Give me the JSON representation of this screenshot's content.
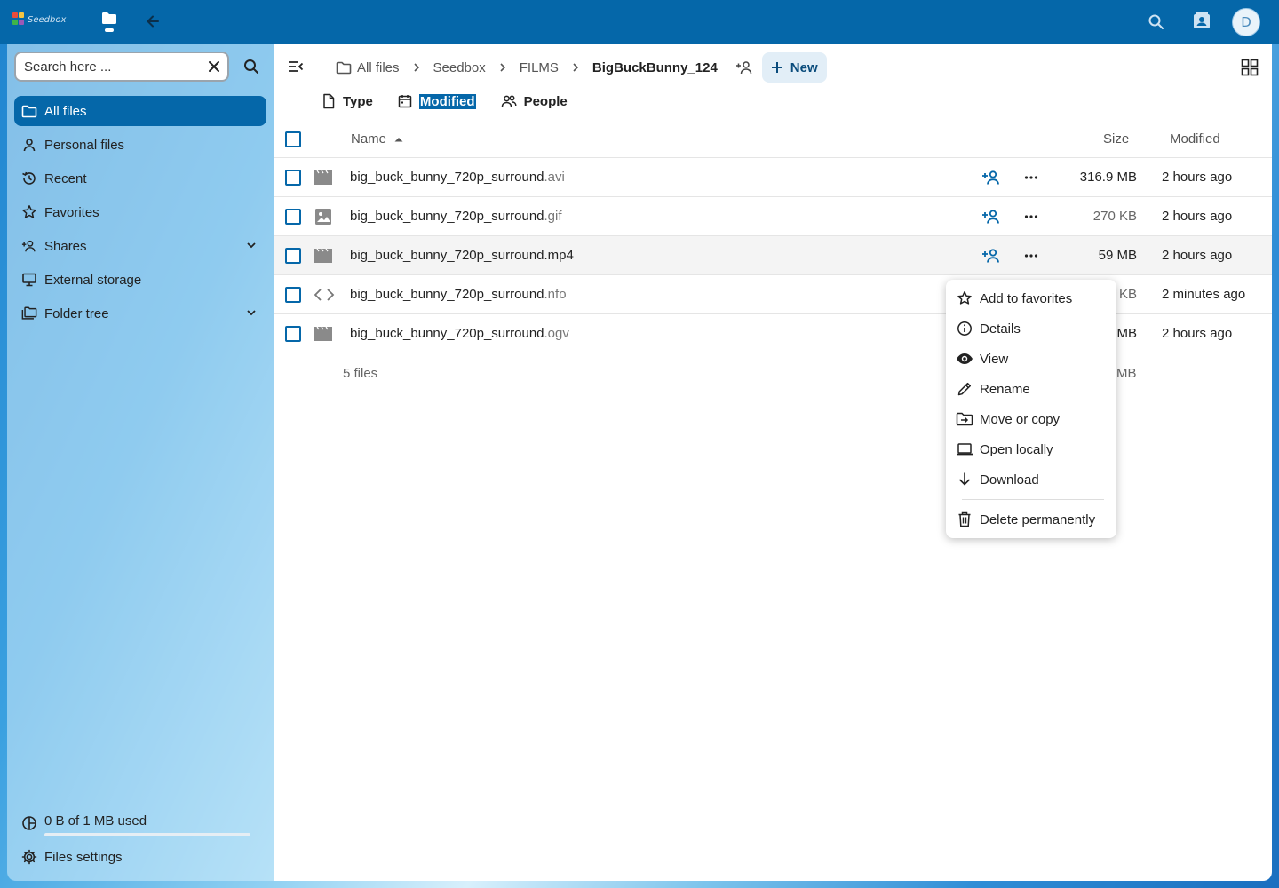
{
  "topbar": {
    "logo_text": "Seedbox",
    "avatar_initial": "D"
  },
  "sidebar": {
    "search_placeholder": "Search here ...",
    "items": [
      {
        "label": "All files",
        "icon": "folder-icon",
        "active": true
      },
      {
        "label": "Personal files",
        "icon": "person-icon"
      },
      {
        "label": "Recent",
        "icon": "history-icon"
      },
      {
        "label": "Favorites",
        "icon": "star-icon"
      },
      {
        "label": "Shares",
        "icon": "share-icon",
        "expandable": true
      },
      {
        "label": "External storage",
        "icon": "monitor-icon"
      },
      {
        "label": "Folder tree",
        "icon": "folder-multiple-icon",
        "expandable": true
      }
    ],
    "quota_text": "0 B of 1 MB used",
    "quota_used_fraction": 0,
    "settings_label": "Files settings"
  },
  "breadcrumb": {
    "items": [
      "All files",
      "Seedbox",
      "FILMS",
      "BigBuckBunny_124"
    ],
    "new_label": "New"
  },
  "filters": {
    "type": "Type",
    "modified": "Modified",
    "people": "People"
  },
  "table": {
    "col_name": "Name",
    "col_size": "Size",
    "col_modified": "Modified",
    "rows": [
      {
        "base": "big_buck_bunny_720p_surround",
        "ext": ".avi",
        "icon": "video-icon",
        "size": "316.9 MB",
        "modified": "2 hours ago"
      },
      {
        "base": "big_buck_bunny_720p_surround",
        "ext": ".gif",
        "icon": "image-icon",
        "size": "270 KB",
        "modified": "2 hours ago"
      },
      {
        "base": "big_buck_bunny_720p_surround",
        "ext": ".mp4",
        "icon": "video-icon",
        "size": "59 MB",
        "modified": "2 hours ago"
      },
      {
        "base": "big_buck_bunny_720p_surround",
        "ext": ".nfo",
        "icon": "code-icon",
        "size": "KB",
        "modified": "2 minutes ago"
      },
      {
        "base": "big_buck_bunny_720p_surround",
        "ext": ".ogv",
        "icon": "video-icon",
        "size": "MB",
        "modified": "2 hours ago"
      }
    ],
    "summary": "5 files",
    "summary_size": "MB"
  },
  "context_menu": {
    "items": [
      {
        "label": "Add to favorites",
        "icon": "star-icon"
      },
      {
        "label": "Details",
        "icon": "info-icon"
      },
      {
        "label": "View",
        "icon": "eye-icon"
      },
      {
        "label": "Rename",
        "icon": "pencil-icon"
      },
      {
        "label": "Move or copy",
        "icon": "folder-move-icon"
      },
      {
        "label": "Open locally",
        "icon": "laptop-icon"
      },
      {
        "label": "Download",
        "icon": "download-icon"
      }
    ],
    "delete_label": "Delete permanently"
  },
  "colors": {
    "primary": "#0567a9",
    "topbar": "#0567a9",
    "text": "#222222"
  }
}
